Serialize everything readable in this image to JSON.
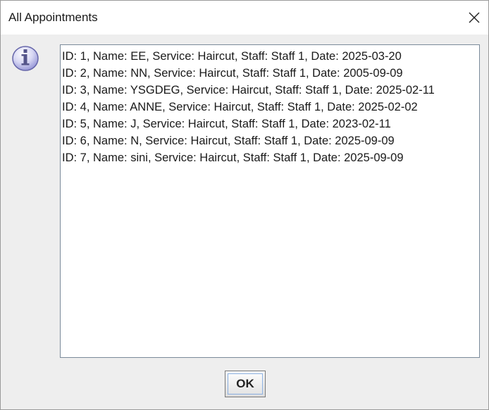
{
  "window": {
    "title": "All Appointments",
    "close_icon": "close-icon"
  },
  "message_icon": "info-icon",
  "appointments": [
    "ID: 1, Name: EE, Service: Haircut, Staff: Staff 1, Date: 2025-03-20",
    "ID: 2, Name: NN, Service: Haircut, Staff: Staff 1, Date: 2005-09-09",
    "ID: 3, Name: YSGDEG, Service: Haircut, Staff: Staff 1, Date: 2025-02-11",
    "ID: 4, Name: ANNE, Service: Haircut, Staff: Staff 1, Date: 2025-02-02",
    "ID: 5, Name: J, Service: Haircut, Staff: Staff 1, Date: 2023-02-11",
    "ID: 6, Name: N, Service: Haircut, Staff: Staff 1, Date: 2025-09-09",
    "ID: 7, Name: sini, Service: Haircut, Staff: Staff 1, Date: 2025-09-09"
  ],
  "buttons": {
    "ok_label": "OK"
  }
}
